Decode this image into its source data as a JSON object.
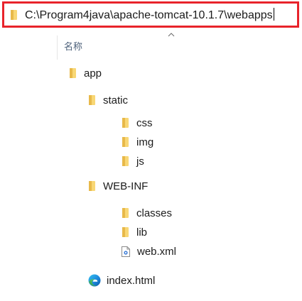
{
  "address_bar": {
    "path": "C:\\Program4java\\apache-tomcat-10.1.7\\webapps"
  },
  "column_header": {
    "name_label": "名称"
  },
  "tree": {
    "app": "app",
    "static": "static",
    "css": "css",
    "img": "img",
    "js": "js",
    "web_inf": "WEB-INF",
    "classes": "classes",
    "lib": "lib",
    "web_xml": "web.xml",
    "index_html": "index.html"
  },
  "colors": {
    "highlight_border": "#e8232b",
    "folder": "#f8d775"
  }
}
